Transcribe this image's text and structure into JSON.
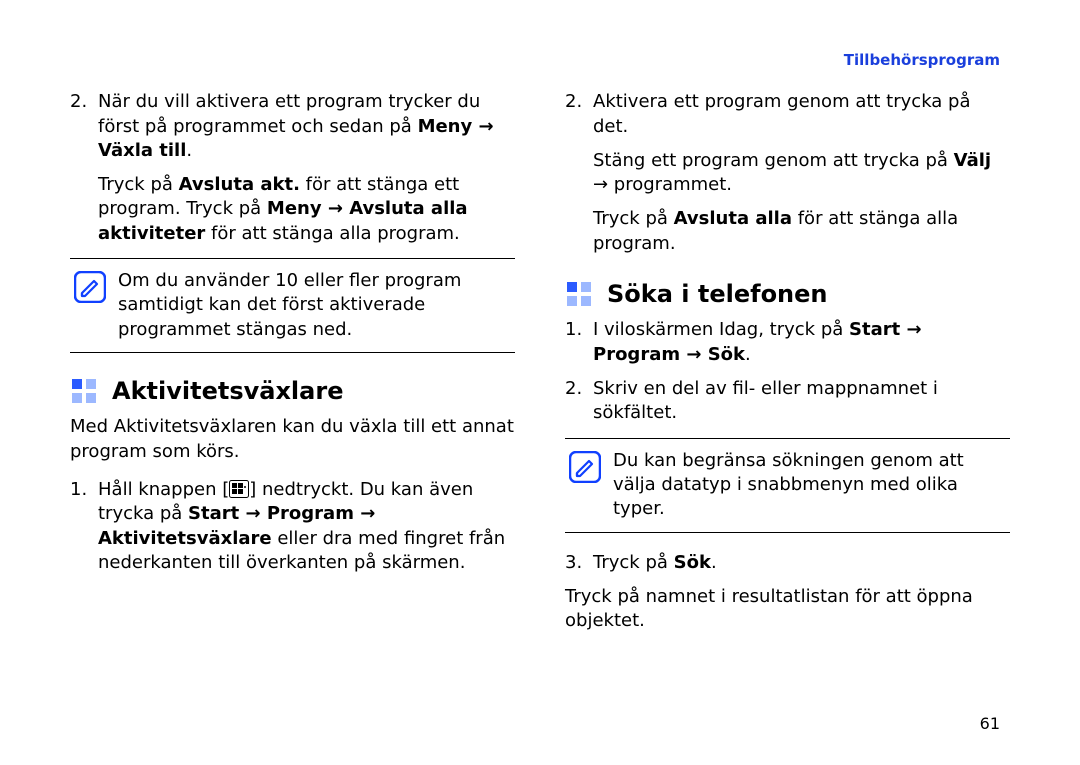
{
  "header": {
    "category": "Tillbehörsprogram"
  },
  "page_number": "61",
  "left": {
    "item2": {
      "num": "2.",
      "part_a_pre": "När du vill aktivera ett program trycker du först på programmet och sedan på ",
      "part_a_bold": "Meny → Växla till",
      "part_a_post": ".",
      "part_b_1": "Tryck på ",
      "part_b_2_bold": "Avsluta akt.",
      "part_b_3": " för att stänga ett program. Tryck på ",
      "part_b_4_bold": "Meny → Avsluta alla aktiviteter",
      "part_b_5": " för att stänga alla program."
    },
    "note": "Om du använder 10 eller fler program samtidigt kan det först aktiverade programmet stängas ned.",
    "section_title": "Aktivitetsväxlare",
    "intro": "Med Aktivitetsväxlaren kan du växla till ett annat program som körs.",
    "item1": {
      "num": "1.",
      "p1": "Håll knappen [",
      "p2": "] nedtryckt. Du kan även trycka på ",
      "p2_bold": "Start → Program → Aktivitetsväxlare",
      "p3": " eller dra med fingret från nederkanten till överkanten på skärmen."
    }
  },
  "right": {
    "item2": {
      "num": "2.",
      "line": "Aktivera ett program genom att trycka på det.",
      "after_a_1": "Stäng ett program genom att trycka på ",
      "after_a_2_bold": "Välj",
      "after_a_3": " → programmet.",
      "after_b_1": "Tryck på ",
      "after_b_2_bold": "Avsluta alla",
      "after_b_3": " för att stänga alla program."
    },
    "section_title": "Söka i telefonen",
    "item1": {
      "num": "1.",
      "p1": "I viloskärmen Idag, tryck på ",
      "p2_bold": "Start → Program → Sök",
      "p3": "."
    },
    "item2b": {
      "num": "2.",
      "text": "Skriv en del av fil- eller mappnamnet i sökfältet."
    },
    "note": "Du kan begränsa sökningen genom att välja datatyp i snabbmenyn med olika typer.",
    "item3": {
      "num": "3.",
      "p1": "Tryck på ",
      "p2_bold": "Sök",
      "p3": "."
    },
    "closing": "Tryck på namnet i resultatlistan för att öppna objektet."
  }
}
